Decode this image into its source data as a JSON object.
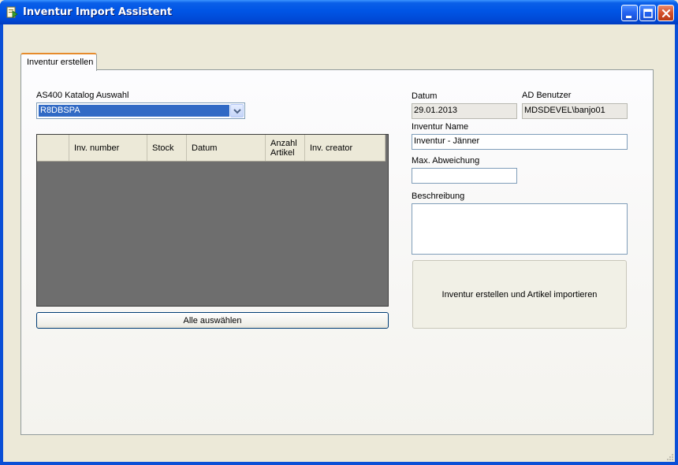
{
  "window": {
    "title": "Inventur Import Assistent",
    "icon": "app-import-icon",
    "titlebar_color": "#0055e5"
  },
  "tabs": [
    {
      "label": "Inventur erstellen",
      "active": true
    }
  ],
  "catalog": {
    "label": "AS400 Katalog Auswahl",
    "selected": "R8DBSPA"
  },
  "grid": {
    "columns": [
      "",
      "Inv. number",
      "Stock",
      "Datum",
      "Anzahl Artikel",
      "Inv. creator"
    ],
    "rows": []
  },
  "buttons": {
    "select_all": "Alle auswählen",
    "create_import": "Inventur erstellen und Artikel importieren"
  },
  "form": {
    "datum_label": "Datum",
    "datum_value": "29.01.2013",
    "ad_user_label": "AD Benutzer",
    "ad_user_value": "MDSDEVEL\\banjo01",
    "name_label": "Inventur Name",
    "name_value": "Inventur - Jänner",
    "max_dev_label": "Max. Abweichung",
    "max_dev_value": "",
    "desc_label": "Beschreibung",
    "desc_value": ""
  }
}
